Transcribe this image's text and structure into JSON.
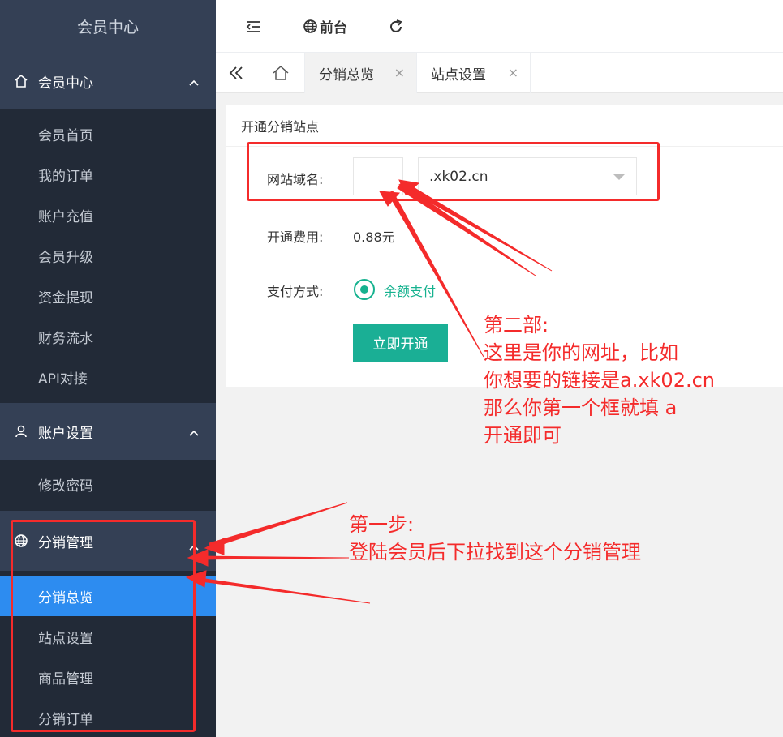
{
  "sidebar": {
    "logo": "会员中心",
    "groups": [
      {
        "label": "会员中心",
        "items": [
          "会员首页",
          "我的订单",
          "账户充值",
          "会员升级",
          "资金提现",
          "财务流水",
          "API对接"
        ]
      },
      {
        "label": "账户设置",
        "items": [
          "修改密码"
        ]
      },
      {
        "label": "分销管理",
        "items": [
          "分销总览",
          "站点设置",
          "商品管理",
          "分销订单"
        ]
      }
    ],
    "active_item": "分销总览"
  },
  "topbar": {
    "front_label": "前台"
  },
  "tabs": [
    {
      "label": "分销总览",
      "close": "×"
    },
    {
      "label": "站点设置",
      "close": "×"
    }
  ],
  "card": {
    "title": "开通分销站点",
    "domain_label": "网站域名:",
    "subdomain_value": "",
    "domain_suffix": ".xk02.cn",
    "fee_label": "开通费用:",
    "fee_value": "0.88元",
    "pay_label": "支付方式:",
    "pay_option": "余额支付",
    "submit_label": "立即开通"
  },
  "annotations": {
    "step2": [
      "第二部:",
      "这里是你的网址，比如",
      "你想要的链接是a.xk02.cn",
      "那么你第一个框就填 a",
      "开通即可"
    ],
    "step1": [
      "第一步:",
      "登陆会员后下拉找到这个分销管理"
    ]
  },
  "colors": {
    "sidebar_bg": "#28303f",
    "sidebar_header_bg": "#344055",
    "active_blue": "#2d8cf0",
    "accent_green": "#1aaf95",
    "annotation_red": "#f42b2b"
  }
}
